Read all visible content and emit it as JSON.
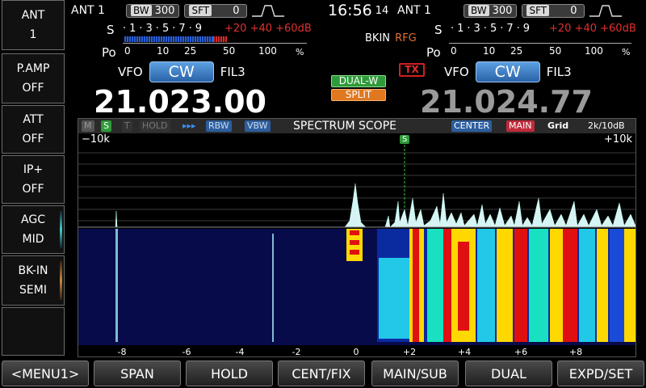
{
  "left_panel": [
    {
      "label": "ANT",
      "value": "1"
    },
    {
      "label": "P.AMP",
      "value": "OFF"
    },
    {
      "label": "ATT",
      "value": "OFF"
    },
    {
      "label": "IP+",
      "value": "OFF"
    },
    {
      "label": "AGC",
      "value": "MID"
    },
    {
      "label": "BK-IN",
      "value": "SEMI"
    }
  ],
  "clock": {
    "time": "16:56",
    "seconds": "14"
  },
  "main": {
    "ant": "ANT 1",
    "bw_key": "BW",
    "bw_value": "300",
    "sft_key": "SFT",
    "sft_value": "0",
    "meter_s_label": "S",
    "meter_s_scale": "·1·3·5·7·9",
    "meter_over": "+20 +40 +60dB",
    "meter_po_label": "Po",
    "meter_po_scale": [
      "0",
      "10",
      "25",
      "50",
      "100"
    ],
    "meter_po_unit": "%",
    "vfo_label": "VFO",
    "mode": "CW",
    "filter": "FIL3",
    "frequency": "21.023.00"
  },
  "sub": {
    "ant": "ANT 1",
    "bw_key": "BW",
    "bw_value": "300",
    "sft_key": "SFT",
    "sft_value": "0",
    "meter_s_label": "S",
    "meter_s_scale": "·1·3·5·7·9",
    "meter_over": "+20 +40 +60dB",
    "meter_po_label": "Po",
    "meter_po_scale": [
      "0",
      "10",
      "25",
      "50",
      "100"
    ],
    "meter_po_unit": "%",
    "vfo_label": "VFO",
    "mode": "CW",
    "filter": "FIL3",
    "frequency": "21.024.77"
  },
  "indicators": {
    "bkin": "BKIN",
    "rfg": "RFG",
    "tx": "TX",
    "dual_w": "DUAL-W",
    "split": "SPLIT"
  },
  "scope": {
    "flags": [
      "M",
      "S",
      "T",
      "HOLD",
      "▸▸▸",
      "RBW",
      "VBW"
    ],
    "title": "SPECTRUM SCOPE",
    "center": "CENTER",
    "main": "MAIN",
    "grid": "Grid",
    "span": "2k/10dB",
    "left_edge": "−10k",
    "right_edge": "+10k",
    "marker": "S",
    "axis_ticks": [
      "-8",
      "-6",
      "-4",
      "-2",
      "0",
      "+2",
      "+4",
      "+6",
      "+8"
    ]
  },
  "softkeys": [
    "<MENU1>",
    "SPAN",
    "HOLD",
    "CENT/FIX",
    "MAIN/SUB",
    "DUAL",
    "EXPD/SET"
  ],
  "colors": {
    "mode_blue": "#3a7fd0",
    "dual_w_green": "#2f9a3a",
    "split_orange": "#e07820",
    "tx_red": "#d02020",
    "meter_blue": "#2a5fd8",
    "meter_red": "#d03030"
  }
}
